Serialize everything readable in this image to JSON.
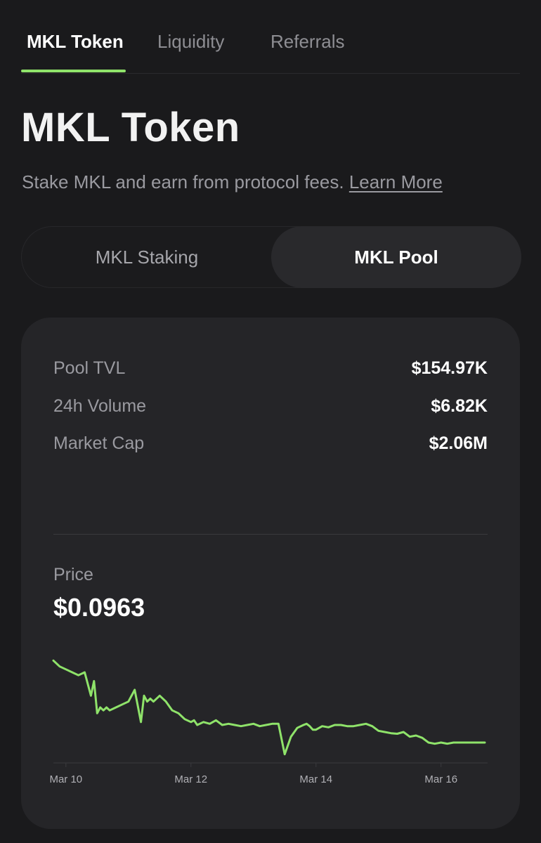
{
  "tabs": [
    {
      "label": "MKL Token",
      "active": true
    },
    {
      "label": "Liquidity",
      "active": false
    },
    {
      "label": "Referrals",
      "active": false
    }
  ],
  "page": {
    "title": "MKL Token",
    "subtitle": "Stake MKL and earn from protocol fees.",
    "learn_more": "Learn More"
  },
  "segments": [
    {
      "label": "MKL Staking",
      "active": false
    },
    {
      "label": "MKL Pool",
      "active": true
    }
  ],
  "stats": [
    {
      "label": "Pool TVL",
      "value": "$154.97K"
    },
    {
      "label": "24h Volume",
      "value": "$6.82K"
    },
    {
      "label": "Market Cap",
      "value": "$2.06M"
    }
  ],
  "price": {
    "label": "Price",
    "value": "$0.0963"
  },
  "colors": {
    "accent": "#8fe36a",
    "background": "#1a1a1c",
    "card": "#252528"
  },
  "chart_data": {
    "type": "line",
    "xlabel": "",
    "ylabel": "",
    "x_tick_labels": [
      "Mar 10",
      "Mar 12",
      "Mar 14",
      "Mar 16"
    ],
    "x_tick_positions": [
      0,
      2,
      4,
      6
    ],
    "grid": false,
    "series": [
      {
        "name": "",
        "color": "#8fe36a",
        "x": [
          -0.2,
          -0.1,
          0.0,
          0.1,
          0.2,
          0.3,
          0.4,
          0.45,
          0.5,
          0.55,
          0.6,
          0.65,
          0.7,
          0.8,
          0.9,
          1.0,
          1.1,
          1.2,
          1.25,
          1.3,
          1.35,
          1.4,
          1.5,
          1.6,
          1.7,
          1.8,
          1.9,
          2.0,
          2.05,
          2.1,
          2.2,
          2.3,
          2.4,
          2.5,
          2.6,
          2.7,
          2.8,
          2.9,
          3.0,
          3.1,
          3.2,
          3.3,
          3.4,
          3.5,
          3.6,
          3.7,
          3.8,
          3.85,
          3.9,
          3.95,
          4.0,
          4.1,
          4.2,
          4.3,
          4.4,
          4.5,
          4.6,
          4.7,
          4.8,
          4.9,
          5.0,
          5.1,
          5.2,
          5.3,
          5.4,
          5.5,
          5.6,
          5.7,
          5.8,
          5.9,
          6.0,
          6.1,
          6.2,
          6.3,
          6.4,
          6.5,
          6.6,
          6.7
        ],
        "values": [
          0.117,
          0.116,
          0.1155,
          0.115,
          0.1145,
          0.115,
          0.111,
          0.1135,
          0.108,
          0.109,
          0.1085,
          0.109,
          0.1085,
          0.109,
          0.1095,
          0.11,
          0.112,
          0.1065,
          0.111,
          0.11,
          0.1105,
          0.11,
          0.111,
          0.11,
          0.1085,
          0.108,
          0.107,
          0.1065,
          0.1068,
          0.106,
          0.1065,
          0.1062,
          0.1068,
          0.106,
          0.1062,
          0.106,
          0.1058,
          0.106,
          0.1062,
          0.1058,
          0.106,
          0.1062,
          0.1062,
          0.101,
          0.104,
          0.1055,
          0.106,
          0.1062,
          0.1058,
          0.1052,
          0.1052,
          0.1058,
          0.1056,
          0.106,
          0.106,
          0.1058,
          0.1058,
          0.106,
          0.1062,
          0.1058,
          0.105,
          0.1048,
          0.1046,
          0.1045,
          0.1048,
          0.104,
          0.1042,
          0.1038,
          0.103,
          0.1028,
          0.103,
          0.1028,
          0.103,
          0.103,
          0.103,
          0.103,
          0.103,
          0.103
        ]
      }
    ]
  }
}
